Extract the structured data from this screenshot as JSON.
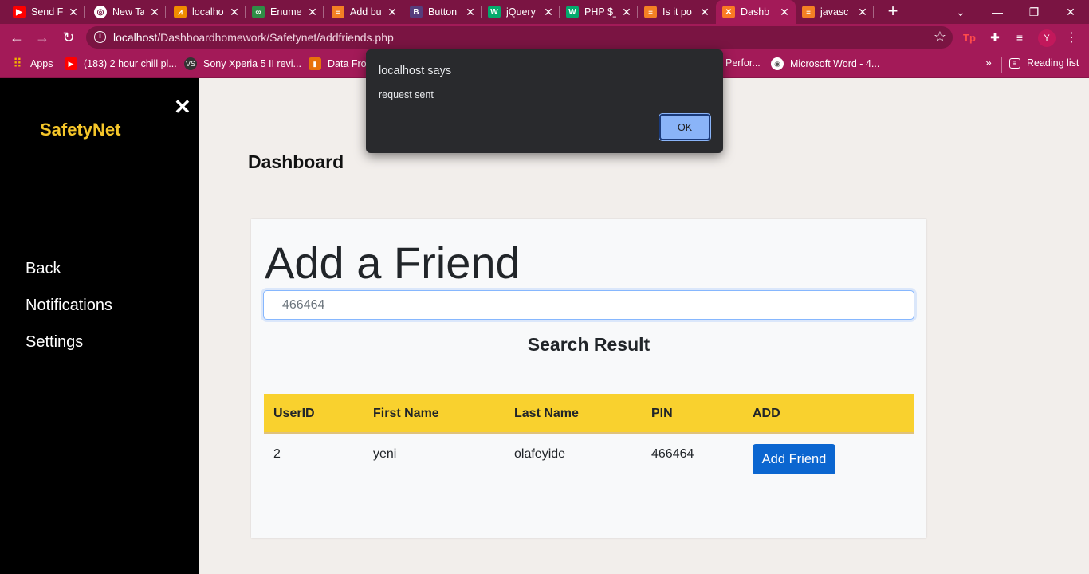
{
  "browser": {
    "tabs": [
      {
        "title": "Send F",
        "icon": "youtube-icon",
        "color": "#ff0000",
        "glyph": "▶"
      },
      {
        "title": "New Ta",
        "icon": "chrome-icon",
        "color": "#ffffff",
        "glyph": "◎"
      },
      {
        "title": "localho",
        "icon": "xampp-icon",
        "color": "#f08c00",
        "glyph": "⩘"
      },
      {
        "title": "Enume",
        "icon": "geeksforgeeks-icon",
        "color": "#2f8d46",
        "glyph": "∞"
      },
      {
        "title": "Add bu",
        "icon": "stackoverflow-icon",
        "color": "#f48024",
        "glyph": "≡"
      },
      {
        "title": "Button",
        "icon": "bootstrap-icon",
        "color": "#563d7c",
        "glyph": "B"
      },
      {
        "title": "jQuery",
        "icon": "w3schools-icon",
        "color": "#04aa6d",
        "glyph": "W"
      },
      {
        "title": "PHP $_",
        "icon": "w3schools-icon",
        "color": "#04aa6d",
        "glyph": "W"
      },
      {
        "title": "Is it po",
        "icon": "stackoverflow-icon",
        "color": "#f48024",
        "glyph": "≡"
      },
      {
        "title": "Dashb",
        "icon": "xampp-icon",
        "color": "#fb7a24",
        "glyph": "✕"
      },
      {
        "title": "javasc",
        "icon": "stackoverflow-icon",
        "color": "#f48024",
        "glyph": "≡"
      }
    ],
    "active_tab_index": 9,
    "address": {
      "host": "localhost",
      "path": "/Dashboardhomework/Safetynet/addfriends.php"
    },
    "profile_initial": "Y",
    "bookmarks": [
      {
        "label": "Apps",
        "icon": "apps-grid-icon",
        "color": "#f5b400",
        "glyph": "⠿"
      },
      {
        "label": "(183) 2 hour chill pl...",
        "icon": "youtube-icon",
        "color": "#ff0000",
        "glyph": "▶"
      },
      {
        "label": "Sony Xperia 5 II revi...",
        "icon": "vs-icon",
        "color": "#333333",
        "glyph": "VS"
      },
      {
        "label": "Data Fron",
        "icon": "chart-icon",
        "color": "#e8710a",
        "glyph": "▮"
      }
    ],
    "bookmarks_right": [
      {
        "label": "Perfor...",
        "icon": "bookmark-icon"
      },
      {
        "label": "Microsoft Word - 4...",
        "icon": "globe-icon"
      }
    ],
    "reading_list": "Reading list"
  },
  "sidebar": {
    "brand": "SafetyNet",
    "close_glyph": "✕",
    "items": [
      {
        "label": "Back"
      },
      {
        "label": "Notifications"
      },
      {
        "label": "Settings"
      }
    ]
  },
  "main": {
    "title": "Dashboard",
    "card": {
      "heading": "Add a Friend",
      "search_value": "466464",
      "result_heading": "Search Result",
      "columns": [
        "UserID",
        "First Name",
        "Last Name",
        "PIN",
        "ADD"
      ],
      "rows": [
        {
          "userid": "2",
          "first_name": "yeni",
          "last_name": "olafeyide",
          "pin": "466464",
          "action": "Add Friend"
        }
      ]
    }
  },
  "dialog": {
    "title": "localhost says",
    "message": "request sent",
    "ok_label": "OK"
  },
  "colors": {
    "browser_frame": "#a31a58",
    "brand_yellow": "#f5c62a",
    "table_header": "#f9d12e",
    "primary_button": "#0b66d0"
  }
}
